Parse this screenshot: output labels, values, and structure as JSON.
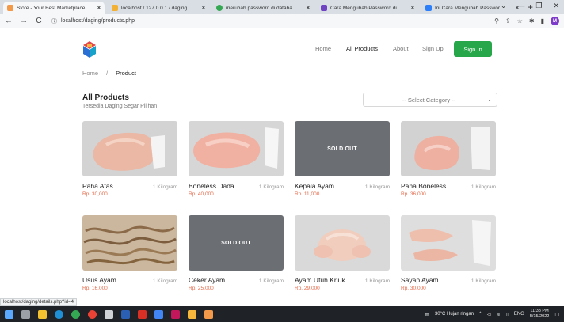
{
  "browser": {
    "tabs": [
      {
        "title": "Store - Your Best Marketplace",
        "color": "#f2994a",
        "active": true
      },
      {
        "title": "localhost / 127.0.0.1 / daging",
        "color": "#f2b134",
        "active": false
      },
      {
        "title": "merubah password di databa",
        "color": "#34a853",
        "active": false
      },
      {
        "title": "Cara Mengubah Password di",
        "color": "#6f42c1",
        "active": false
      },
      {
        "title": "Ini Cara Mengubah Passwor",
        "color": "#2d7ff9",
        "active": false
      }
    ],
    "url": "localhost/daging/products.php",
    "profile_initial": "M"
  },
  "site": {
    "nav": {
      "home": "Home",
      "products": "All Products",
      "about": "About",
      "signup": "Sign Up",
      "signin": "Sign In"
    },
    "breadcrumb": {
      "home": "Home",
      "separator": "/",
      "current": "Product"
    },
    "section": {
      "title": "All Products",
      "subtitle": "Tersedia Daging Segar Pilihan"
    },
    "category_select": {
      "value": "-- Select Category --"
    },
    "accent": "#27a74a",
    "price_color": "#e46a4a",
    "products": [
      {
        "name": "Paha Atas",
        "weight": "1 Kilogram",
        "price": "Rp. 30,000",
        "soldout": false,
        "image": "chicken-thigh"
      },
      {
        "name": "Boneless Dada",
        "weight": "1 Kilogram",
        "price": "Rp. 40,000",
        "soldout": false,
        "image": "chicken-breast"
      },
      {
        "name": "Kepala Ayam",
        "weight": "1 Kilogram",
        "price": "Rp. 11,000",
        "soldout": true,
        "soldout_label": "SOLD OUT"
      },
      {
        "name": "Paha Boneless",
        "weight": "1 Kilogram",
        "price": "Rp. 36,000",
        "soldout": false,
        "image": "boneless-thigh"
      },
      {
        "name": "Usus Ayam",
        "weight": "1 Kilogram",
        "price": "Rp. 16,000",
        "soldout": false,
        "image": "chicken-intestine"
      },
      {
        "name": "Ceker Ayam",
        "weight": "1 Kilogram",
        "price": "Rp. 25,000",
        "soldout": true,
        "soldout_label": "SOLD OUT"
      },
      {
        "name": "Ayam Utuh Kriuk",
        "weight": "1 Kilogram",
        "price": "Rp. 29,000",
        "soldout": false,
        "image": "whole-chicken"
      },
      {
        "name": "Sayap Ayam",
        "weight": "1 Kilogram",
        "price": "Rp. 30,000",
        "soldout": false,
        "image": "chicken-wings"
      }
    ]
  },
  "status_url": "localhost/daging/details.php?id=4",
  "taskbar": {
    "weather": "30°C  Hujan ringan",
    "lang": "ENG",
    "time": "11:38 PM",
    "date": "5/15/2022"
  }
}
